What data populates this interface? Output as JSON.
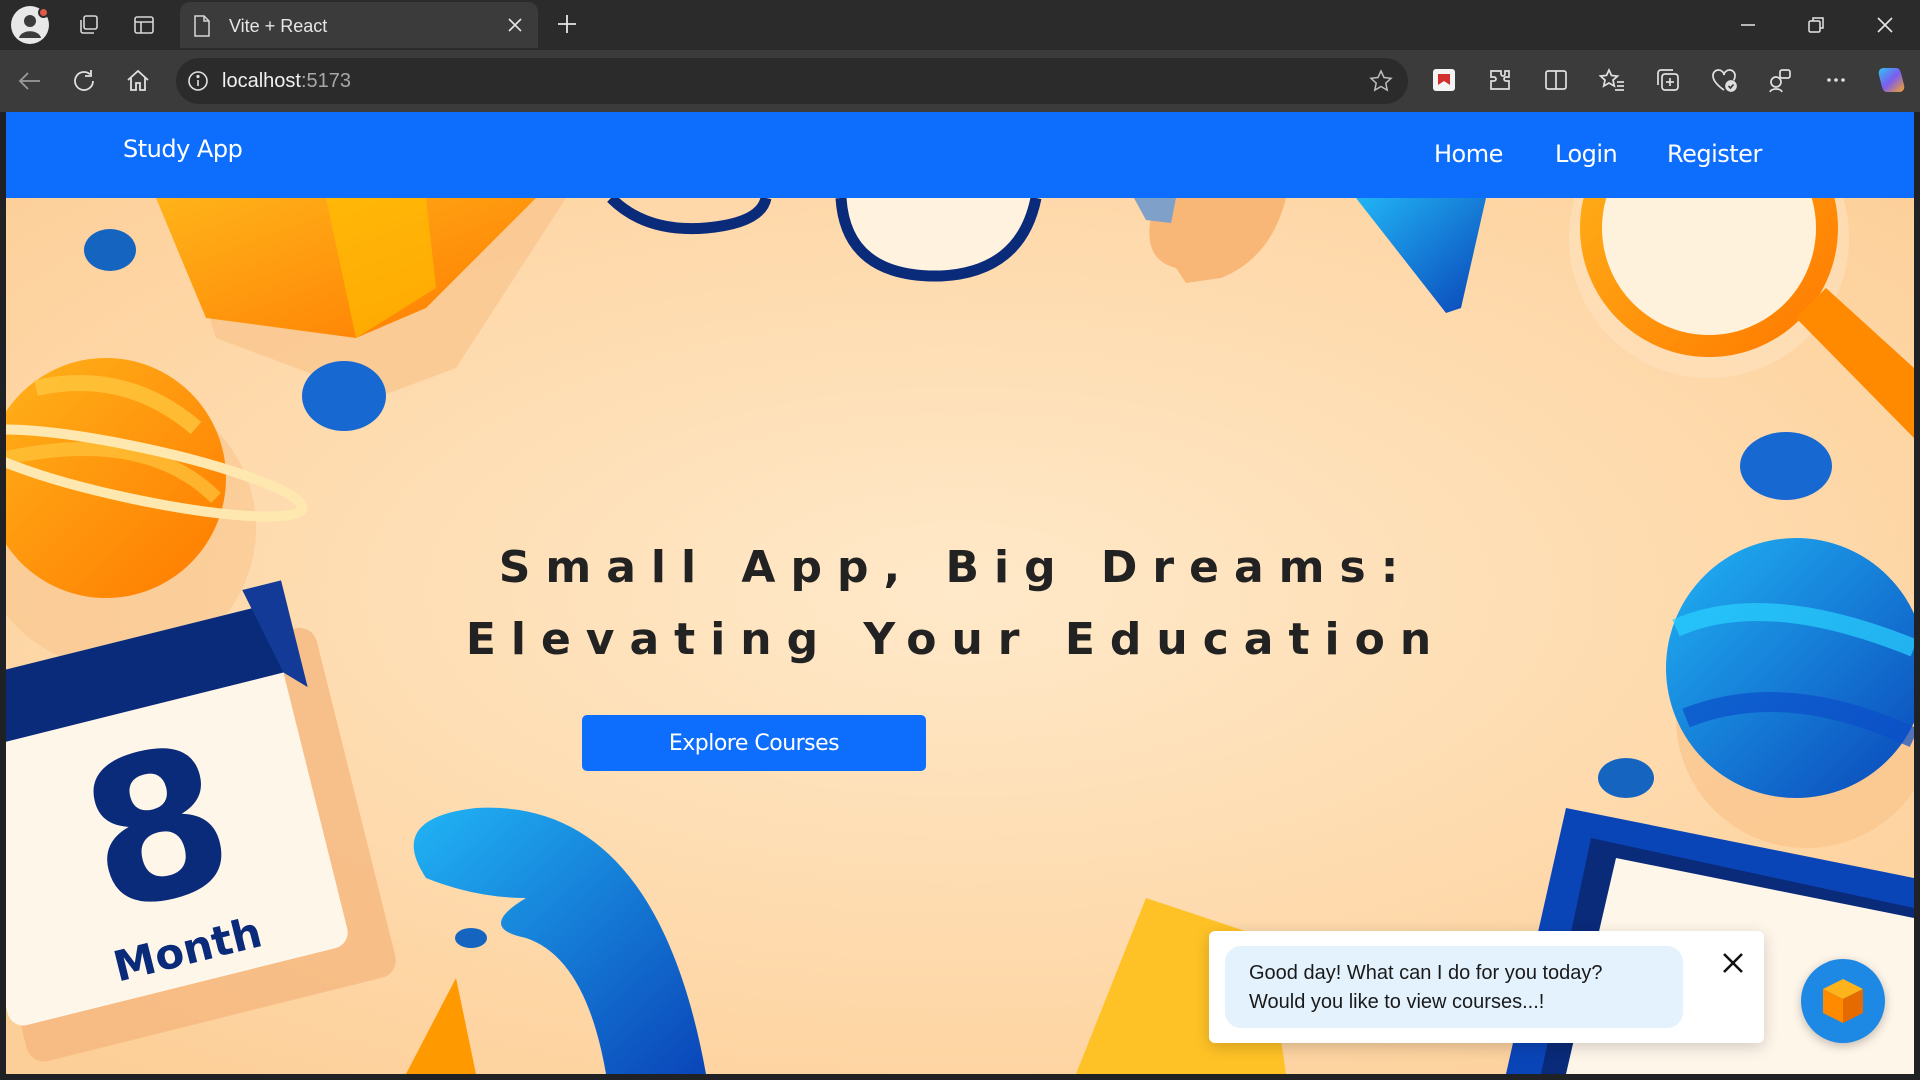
{
  "browser": {
    "tab_title": "Vite + React",
    "url_host": "localhost",
    "url_port": ":5173"
  },
  "navbar": {
    "brand": "Study App",
    "links": [
      "Home",
      "Login",
      "Register"
    ]
  },
  "hero": {
    "title_line1": "Small App, Big Dreams:",
    "title_line2": "Elevating Your Education",
    "cta": "Explore Courses",
    "calendar_number": "8",
    "calendar_label": "Month"
  },
  "chat": {
    "message_line1": "Good day! What can I do for you today?",
    "message_line2": "Would you like to view courses...!"
  },
  "colors": {
    "primary": "#0d6efd",
    "hero_background": "#fed9ac",
    "orange": "#ff8a00",
    "navy": "#0a2a7a",
    "blue": "#1565c0"
  },
  "icons": [
    "profile-icon",
    "workspaces-icon",
    "tab-actions-icon",
    "page-icon",
    "close-icon",
    "plus-icon",
    "minimize-icon",
    "restore-icon",
    "back-icon",
    "refresh-icon",
    "home-icon",
    "info-icon",
    "star-icon",
    "extensions-icon",
    "split-screen-icon",
    "favorites-icon",
    "collections-icon",
    "copilot-icon"
  ]
}
